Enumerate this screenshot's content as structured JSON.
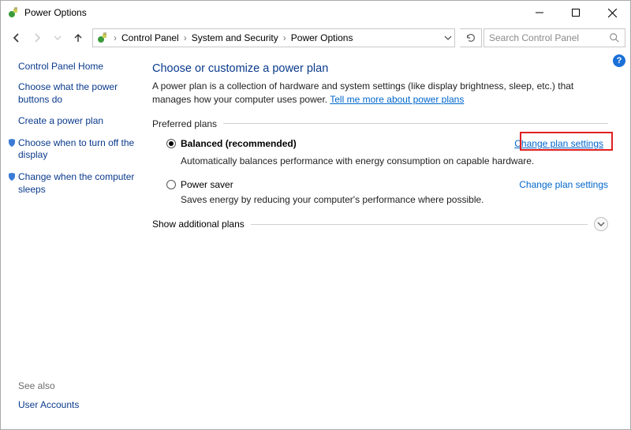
{
  "window": {
    "title": "Power Options"
  },
  "breadcrumb": {
    "items": [
      "Control Panel",
      "System and Security",
      "Power Options"
    ]
  },
  "search": {
    "placeholder": "Search Control Panel"
  },
  "sidebar": {
    "home": "Control Panel Home",
    "links": [
      "Choose what the power buttons do",
      "Create a power plan",
      "Choose when to turn off the display",
      "Change when the computer sleeps"
    ],
    "see_also_label": "See also",
    "see_also_links": [
      "User Accounts"
    ]
  },
  "main": {
    "heading": "Choose or customize a power plan",
    "lead": "A power plan is a collection of hardware and system settings (like display brightness, sleep, etc.) that manages how your computer uses power.",
    "tell_more": "Tell me more about power plans",
    "preferred_label": "Preferred plans",
    "plans": [
      {
        "name": "Balanced (recommended)",
        "desc": "Automatically balances performance with energy consumption on capable hardware.",
        "change": "Change plan settings",
        "selected": true,
        "highlight": true
      },
      {
        "name": "Power saver",
        "desc": "Saves energy by reducing your computer's performance where possible.",
        "change": "Change plan settings",
        "selected": false,
        "highlight": false
      }
    ],
    "show_additional": "Show additional plans"
  }
}
